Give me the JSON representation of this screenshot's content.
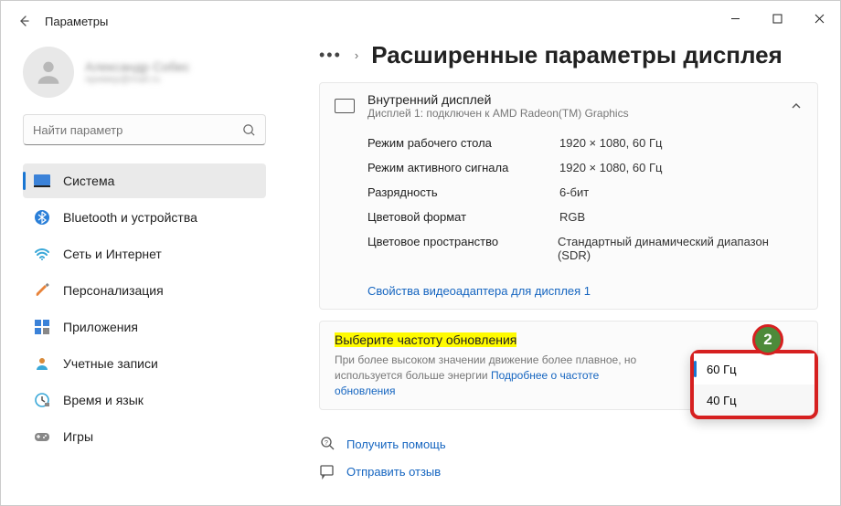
{
  "window": {
    "title": "Параметры"
  },
  "profile": {
    "name": "Александр Собес",
    "email": "пример@mail.ru"
  },
  "search": {
    "placeholder": "Найти параметр"
  },
  "sidebar": {
    "items": [
      {
        "label": "Система"
      },
      {
        "label": "Bluetooth и устройства"
      },
      {
        "label": "Сеть и Интернет"
      },
      {
        "label": "Персонализация"
      },
      {
        "label": "Приложения"
      },
      {
        "label": "Учетные записи"
      },
      {
        "label": "Время и язык"
      },
      {
        "label": "Игры"
      }
    ]
  },
  "page": {
    "heading": "Расширенные параметры дисплея"
  },
  "display_card": {
    "title": "Внутренний дисплей",
    "subtitle": "Дисплей 1: подключен к AMD Radeon(TM) Graphics",
    "rows": [
      {
        "label": "Режим рабочего стола",
        "value": "1920 × 1080, 60 Гц"
      },
      {
        "label": "Режим активного сигнала",
        "value": "1920 × 1080, 60 Гц"
      },
      {
        "label": "Разрядность",
        "value": "6-бит"
      },
      {
        "label": "Цветовой формат",
        "value": "RGB"
      },
      {
        "label": "Цветовое пространство",
        "value": "Стандартный динамический диапазон (SDR)"
      }
    ],
    "link": "Свойства видеоадаптера для дисплея 1"
  },
  "refresh": {
    "title": "Выберите частоту обновления",
    "subtitle_a": "При более высоком значении движение более плавное, но используется больше энергии  ",
    "subtitle_link": "Подробнее о частоте обновления",
    "options": [
      {
        "label": "60 Гц"
      },
      {
        "label": "40 Гц"
      }
    ]
  },
  "footer": {
    "help": "Получить помощь",
    "feedback": "Отправить отзыв"
  },
  "annotation": {
    "badge": "2"
  }
}
